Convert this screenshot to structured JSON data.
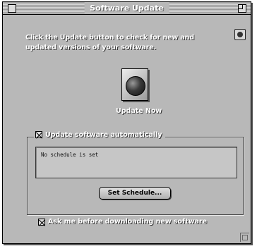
{
  "window": {
    "title": "Software Update"
  },
  "instructions": "Click the Update button to check for new and updated versions of your software.",
  "update_button": {
    "label": "Update Now",
    "icon": "globe-icon"
  },
  "auto_update": {
    "checked": true,
    "label": "Update software automatically",
    "status_text": "No schedule is set"
  },
  "set_schedule_label": "Set Schedule...",
  "ask_before": {
    "checked": true,
    "label": "Ask me before downloading new software"
  },
  "colors": {
    "window_bg": "#b8b8b8",
    "label_text": "#ffffff"
  }
}
